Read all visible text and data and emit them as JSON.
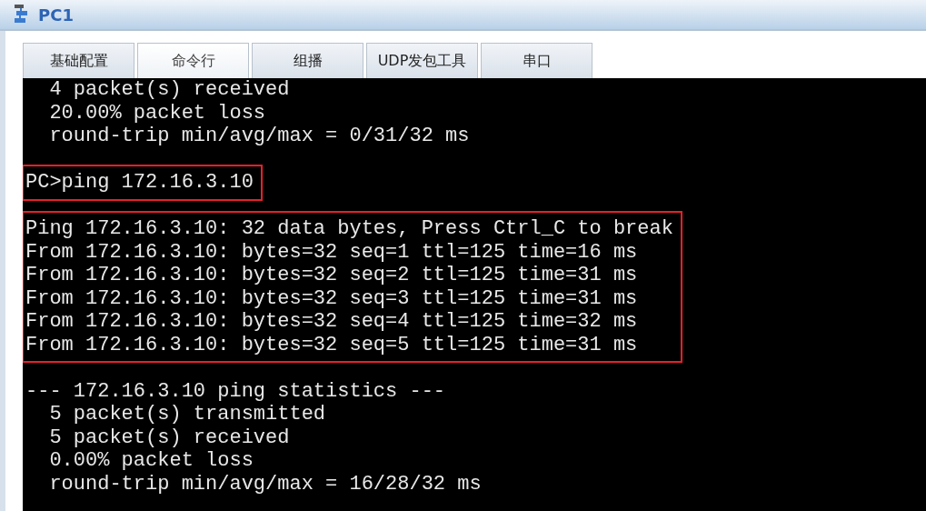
{
  "window": {
    "title": "PC1"
  },
  "tabs": [
    {
      "label": "基础配置",
      "selected": false
    },
    {
      "label": "命令行",
      "selected": true
    },
    {
      "label": "组播",
      "selected": false
    },
    {
      "label": "UDP发包工具",
      "selected": false
    },
    {
      "label": "串口",
      "selected": false
    }
  ],
  "terminal": {
    "blocks": [
      {
        "highlighted": false,
        "lines": [
          "  4 packet(s) received",
          "  20.00% packet loss",
          "  round-trip min/avg/max = 0/31/32 ms"
        ]
      },
      {
        "highlighted": true,
        "lines": [
          "PC>ping 172.16.3.10"
        ]
      },
      {
        "highlighted": true,
        "lines": [
          "Ping 172.16.3.10: 32 data bytes, Press Ctrl_C to break",
          "From 172.16.3.10: bytes=32 seq=1 ttl=125 time=16 ms",
          "From 172.16.3.10: bytes=32 seq=2 ttl=125 time=31 ms",
          "From 172.16.3.10: bytes=32 seq=3 ttl=125 time=31 ms",
          "From 172.16.3.10: bytes=32 seq=4 ttl=125 time=32 ms",
          "From 172.16.3.10: bytes=32 seq=5 ttl=125 time=31 ms"
        ]
      },
      {
        "highlighted": false,
        "lines": [
          "--- 172.16.3.10 ping statistics ---",
          "  5 packet(s) transmitted",
          "  5 packet(s) received",
          "  0.00% packet loss",
          "  round-trip min/avg/max = 16/28/32 ms"
        ]
      }
    ]
  }
}
